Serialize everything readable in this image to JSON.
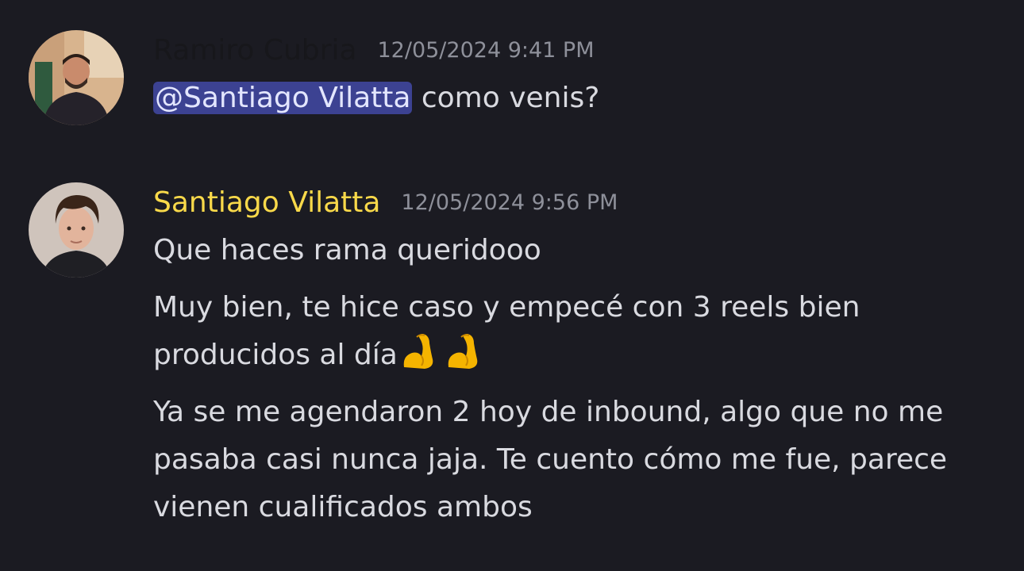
{
  "messages": [
    {
      "author": "Ramiro Cubria",
      "author_color": "#17171b",
      "timestamp": "12/05/2024 9:41 PM",
      "avatar_icon": "user-avatar-photo",
      "mention": "@Santiago Vilatta",
      "text_after_mention": " como venis?"
    },
    {
      "author": "Santiago Vilatta",
      "author_color": "#f9d94a",
      "timestamp": "12/05/2024 9:56 PM",
      "avatar_icon": "user-avatar-photo",
      "paragraphs": [
        "Que haces rama queridooo",
        "Muy bien, te hice caso y empecé con 3 reels bien producidos al día",
        "Ya se me agendaron 2 hoy de inbound, algo que no me pasaba casi nunca jaja. Te cuento cómo me fue, parece vienen cualificados ambos"
      ],
      "emoji_icon": "flexed-biceps-emoji",
      "emoji_count": 2
    }
  ],
  "colors": {
    "background": "#1b1b22",
    "mention_bg": "#3c4292",
    "timestamp": "#8e909a"
  }
}
